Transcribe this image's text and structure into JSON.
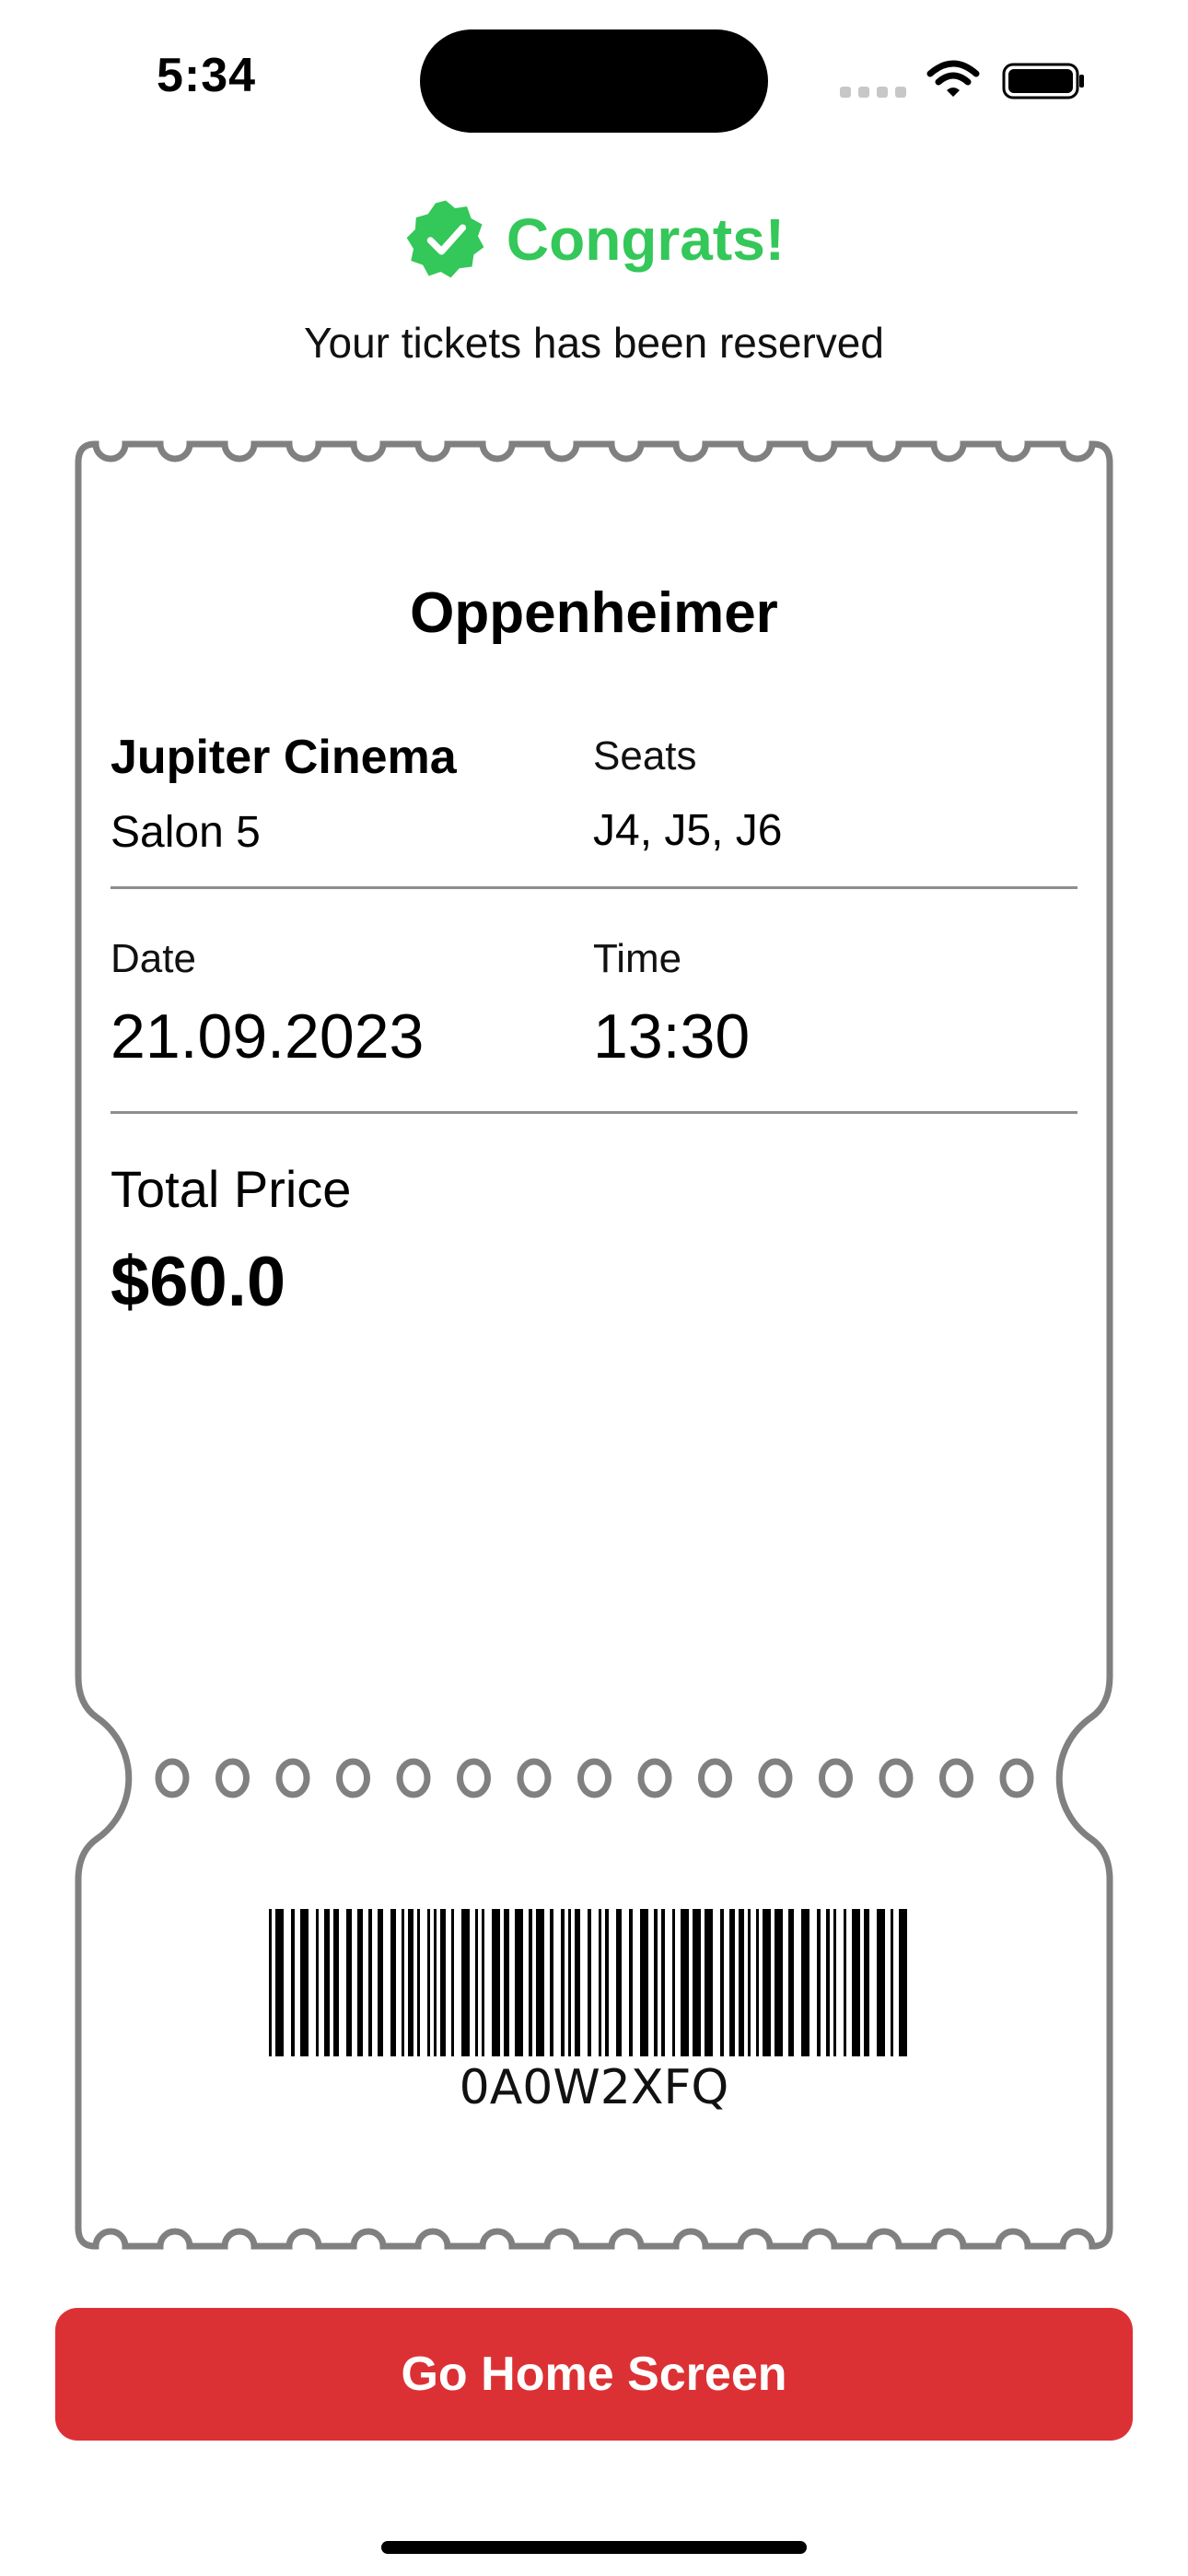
{
  "status_bar": {
    "time": "5:34"
  },
  "header": {
    "title": "Congrats!",
    "subtitle": "Your tickets has been reserved"
  },
  "ticket": {
    "movie_title": "Oppenheimer",
    "cinema_name": "Jupiter Cinema",
    "salon": "Salon 5",
    "seats_label": "Seats",
    "seats_value": "J4, J5, J6",
    "date_label": "Date",
    "date_value": "21.09.2023",
    "time_label": "Time",
    "time_value": "13:30",
    "price_label": "Total Price",
    "price_value": "$60.0",
    "barcode_text": "0A0W2XFQ"
  },
  "actions": {
    "home_button": "Go Home Screen"
  },
  "colors": {
    "accent_green": "#34C759",
    "button_red": "#DC3134",
    "ticket_border": "#808080"
  },
  "icons": {
    "congrats_badge": "checkmark-seal-fill",
    "signal": "cellular-signal",
    "wifi": "wifi",
    "battery": "battery-full"
  }
}
